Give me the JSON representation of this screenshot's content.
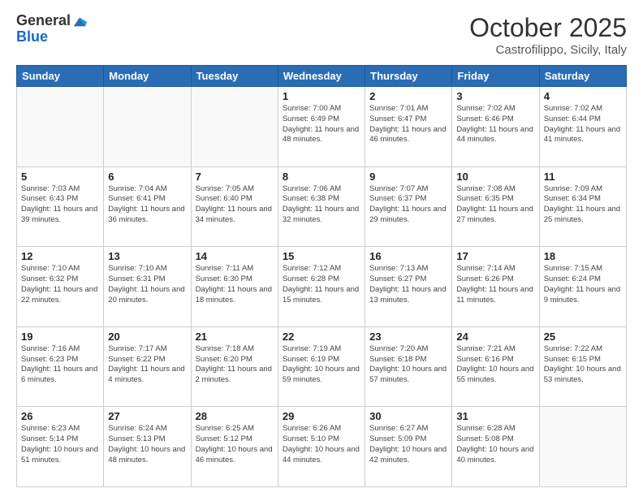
{
  "logo": {
    "general": "General",
    "blue": "Blue"
  },
  "title": {
    "month": "October 2025",
    "location": "Castrofilippo, Sicily, Italy"
  },
  "headers": [
    "Sunday",
    "Monday",
    "Tuesday",
    "Wednesday",
    "Thursday",
    "Friday",
    "Saturday"
  ],
  "weeks": [
    [
      {
        "day": "",
        "info": ""
      },
      {
        "day": "",
        "info": ""
      },
      {
        "day": "",
        "info": ""
      },
      {
        "day": "1",
        "info": "Sunrise: 7:00 AM\nSunset: 6:49 PM\nDaylight: 11 hours and 48 minutes."
      },
      {
        "day": "2",
        "info": "Sunrise: 7:01 AM\nSunset: 6:47 PM\nDaylight: 11 hours and 46 minutes."
      },
      {
        "day": "3",
        "info": "Sunrise: 7:02 AM\nSunset: 6:46 PM\nDaylight: 11 hours and 44 minutes."
      },
      {
        "day": "4",
        "info": "Sunrise: 7:02 AM\nSunset: 6:44 PM\nDaylight: 11 hours and 41 minutes."
      }
    ],
    [
      {
        "day": "5",
        "info": "Sunrise: 7:03 AM\nSunset: 6:43 PM\nDaylight: 11 hours and 39 minutes."
      },
      {
        "day": "6",
        "info": "Sunrise: 7:04 AM\nSunset: 6:41 PM\nDaylight: 11 hours and 36 minutes."
      },
      {
        "day": "7",
        "info": "Sunrise: 7:05 AM\nSunset: 6:40 PM\nDaylight: 11 hours and 34 minutes."
      },
      {
        "day": "8",
        "info": "Sunrise: 7:06 AM\nSunset: 6:38 PM\nDaylight: 11 hours and 32 minutes."
      },
      {
        "day": "9",
        "info": "Sunrise: 7:07 AM\nSunset: 6:37 PM\nDaylight: 11 hours and 29 minutes."
      },
      {
        "day": "10",
        "info": "Sunrise: 7:08 AM\nSunset: 6:35 PM\nDaylight: 11 hours and 27 minutes."
      },
      {
        "day": "11",
        "info": "Sunrise: 7:09 AM\nSunset: 6:34 PM\nDaylight: 11 hours and 25 minutes."
      }
    ],
    [
      {
        "day": "12",
        "info": "Sunrise: 7:10 AM\nSunset: 6:32 PM\nDaylight: 11 hours and 22 minutes."
      },
      {
        "day": "13",
        "info": "Sunrise: 7:10 AM\nSunset: 6:31 PM\nDaylight: 11 hours and 20 minutes."
      },
      {
        "day": "14",
        "info": "Sunrise: 7:11 AM\nSunset: 6:30 PM\nDaylight: 11 hours and 18 minutes."
      },
      {
        "day": "15",
        "info": "Sunrise: 7:12 AM\nSunset: 6:28 PM\nDaylight: 11 hours and 15 minutes."
      },
      {
        "day": "16",
        "info": "Sunrise: 7:13 AM\nSunset: 6:27 PM\nDaylight: 11 hours and 13 minutes."
      },
      {
        "day": "17",
        "info": "Sunrise: 7:14 AM\nSunset: 6:26 PM\nDaylight: 11 hours and 11 minutes."
      },
      {
        "day": "18",
        "info": "Sunrise: 7:15 AM\nSunset: 6:24 PM\nDaylight: 11 hours and 9 minutes."
      }
    ],
    [
      {
        "day": "19",
        "info": "Sunrise: 7:16 AM\nSunset: 6:23 PM\nDaylight: 11 hours and 6 minutes."
      },
      {
        "day": "20",
        "info": "Sunrise: 7:17 AM\nSunset: 6:22 PM\nDaylight: 11 hours and 4 minutes."
      },
      {
        "day": "21",
        "info": "Sunrise: 7:18 AM\nSunset: 6:20 PM\nDaylight: 11 hours and 2 minutes."
      },
      {
        "day": "22",
        "info": "Sunrise: 7:19 AM\nSunset: 6:19 PM\nDaylight: 10 hours and 59 minutes."
      },
      {
        "day": "23",
        "info": "Sunrise: 7:20 AM\nSunset: 6:18 PM\nDaylight: 10 hours and 57 minutes."
      },
      {
        "day": "24",
        "info": "Sunrise: 7:21 AM\nSunset: 6:16 PM\nDaylight: 10 hours and 55 minutes."
      },
      {
        "day": "25",
        "info": "Sunrise: 7:22 AM\nSunset: 6:15 PM\nDaylight: 10 hours and 53 minutes."
      }
    ],
    [
      {
        "day": "26",
        "info": "Sunrise: 6:23 AM\nSunset: 5:14 PM\nDaylight: 10 hours and 51 minutes."
      },
      {
        "day": "27",
        "info": "Sunrise: 6:24 AM\nSunset: 5:13 PM\nDaylight: 10 hours and 48 minutes."
      },
      {
        "day": "28",
        "info": "Sunrise: 6:25 AM\nSunset: 5:12 PM\nDaylight: 10 hours and 46 minutes."
      },
      {
        "day": "29",
        "info": "Sunrise: 6:26 AM\nSunset: 5:10 PM\nDaylight: 10 hours and 44 minutes."
      },
      {
        "day": "30",
        "info": "Sunrise: 6:27 AM\nSunset: 5:09 PM\nDaylight: 10 hours and 42 minutes."
      },
      {
        "day": "31",
        "info": "Sunrise: 6:28 AM\nSunset: 5:08 PM\nDaylight: 10 hours and 40 minutes."
      },
      {
        "day": "",
        "info": ""
      }
    ]
  ]
}
